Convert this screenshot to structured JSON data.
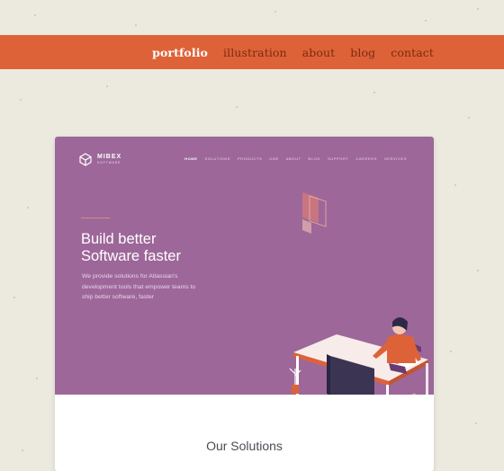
{
  "top_nav": {
    "items": [
      {
        "label": "portfolio",
        "active": true
      },
      {
        "label": "illustration",
        "active": false
      },
      {
        "label": "about",
        "active": false
      },
      {
        "label": "blog",
        "active": false
      },
      {
        "label": "contact",
        "active": false
      }
    ],
    "bar_color": "#de6238"
  },
  "preview": {
    "brand": {
      "name": "MIBEX",
      "subtitle": "SOFTWARE",
      "logo_icon": "cube-icon"
    },
    "nav": [
      {
        "label": "HOME",
        "active": true
      },
      {
        "label": "SOLUTIONS",
        "active": false
      },
      {
        "label": "PRODUCTS",
        "active": false
      },
      {
        "label": "ONE",
        "active": false
      },
      {
        "label": "ABOUT",
        "active": false
      },
      {
        "label": "BLOG",
        "active": false
      },
      {
        "label": "SUPPORT",
        "active": false
      },
      {
        "label": "CAREERS",
        "active": false
      },
      {
        "label": "SERVICES",
        "active": false
      }
    ],
    "hero": {
      "title": "Build better\nSoftware faster",
      "text": "We provide solutions for Atlassian's development tools that empower teams to ship better software, faster",
      "background": "#9d6799",
      "illustration": "developer-at-desk-illustration"
    },
    "section_title": "Our Solutions"
  }
}
